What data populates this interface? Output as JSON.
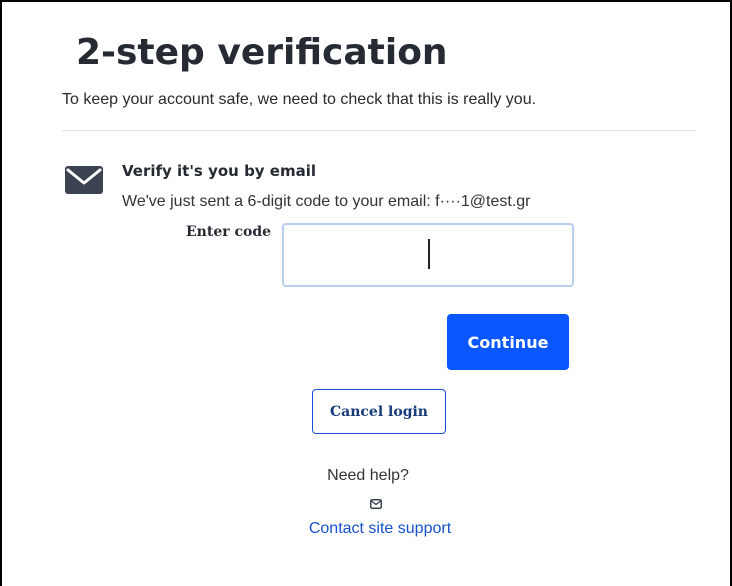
{
  "header": {
    "title": "2-step verification",
    "subtitle": "To keep your account safe, we need to check that this is really you."
  },
  "verify": {
    "heading": "Verify it's you by email",
    "message": "We've just sent a 6-digit code to your email: f····1@test.gr",
    "icon": "envelope-icon"
  },
  "code": {
    "label": "Enter code",
    "value": "",
    "placeholder": ""
  },
  "actions": {
    "continue_label": "Continue",
    "cancel_label": "Cancel login"
  },
  "help": {
    "prompt": "Need help?",
    "icon": "envelope-icon",
    "link_label": "Contact site support"
  },
  "colors": {
    "primary": "#0b57ff",
    "link": "#1552cc",
    "heading": "#262b33"
  }
}
